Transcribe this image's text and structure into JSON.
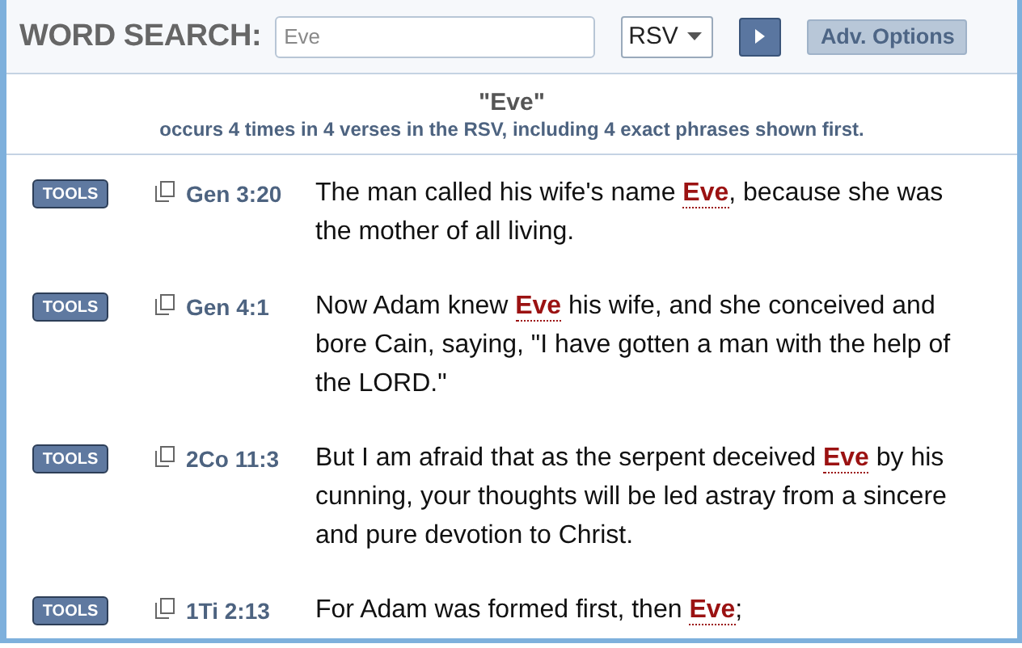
{
  "search_bar": {
    "label": "WORD SEARCH:",
    "query": {
      "value": "Eve"
    },
    "version_select": {
      "value": "RSV"
    },
    "adv_options_button": "Adv. Options"
  },
  "summary": {
    "term": "\"Eve\"",
    "description": "occurs 4 times in 4 verses in the RSV, including 4 exact phrases shown first."
  },
  "results": [
    {
      "tools_button": "TOOLS",
      "reference": "Gen 3:20",
      "text": "The man called his wife's name **Eve**, because she was the mother of all living."
    },
    {
      "tools_button": "TOOLS",
      "reference": "Gen 4:1",
      "text": "Now Adam knew **Eve** his wife, and she conceived and bore Cain, saying, \"I have gotten a man with the help of the LORD.\""
    },
    {
      "tools_button": "TOOLS",
      "reference": "2Co 11:3",
      "text": "But I am afraid that as the serpent deceived **Eve** by his cunning, your thoughts will be led astray from a sincere and pure devotion to Christ."
    },
    {
      "tools_button": "TOOLS",
      "reference": "1Ti 2:13",
      "text": "For Adam was formed first, then **Eve**;"
    }
  ]
}
